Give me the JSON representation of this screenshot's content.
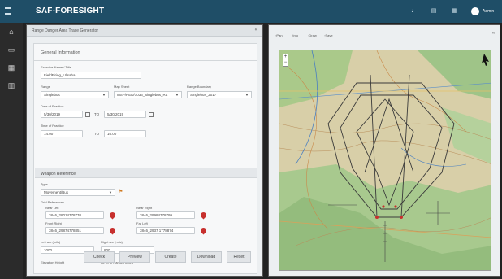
{
  "app": {
    "title": "SAF-FORESIGHT",
    "user": "Admin"
  },
  "topbar": {
    "icons": [
      "bell-icon",
      "document-icon",
      "grid-icon"
    ]
  },
  "leftnav": {
    "items": [
      "home-icon",
      "inbox-icon",
      "calendar-icon",
      "chart-icon"
    ]
  },
  "panel": {
    "title": "Range Danger Area Trace Generator",
    "collapse": "«"
  },
  "general": {
    "title": "General Information",
    "exercise_label": "Exercise Name / Title",
    "exercise_value": "FieldFiring_Ulisaba",
    "range_label": "Range",
    "range_value": "Singlebus",
    "map_label": "Map Sheet",
    "map_value": "MSP/RED/1036_Singlebus_Ra",
    "datum_label": "Range Boundary",
    "datum_value": "Singlebus_2017",
    "date_label": "Date of Practice",
    "date_from": "5/30/2019",
    "date_to_label": "TO",
    "date_to": "5/30/2019",
    "time_label": "Time of Practice",
    "time_from": "14:00",
    "time_to_label": "TO",
    "time_to": "16:00"
  },
  "weapon": {
    "title": "Weapon Reference",
    "type_label": "Type",
    "type_value": "Movement/Bus",
    "grid_label": "Grid References",
    "near_left_label": "Near Left",
    "near_left": "3846_28014778770",
    "near_right_label": "Near Right",
    "near_right": "3846_29984778799",
    "front_right_label": "Front Right",
    "front_right": "3846_29874778851",
    "far_left_label": "Far Left",
    "far_left": "3846_2937 1778874",
    "left_arc_label": "Left arc (mils)",
    "left_arc": "1000",
    "right_arc_label": "Right arc (mils)",
    "right_arc": "800",
    "elevation_label": "Elevation Height",
    "target_label": "Ht. % of Range Height"
  },
  "buttons": {
    "check": "Check",
    "preview": "Preview",
    "create": "Create",
    "download": "Download",
    "reset": "Reset"
  },
  "map": {
    "tools": [
      "Pan",
      "Info",
      "Draw",
      "Save"
    ],
    "close": "«",
    "zoom_in": "+",
    "zoom_out": "−"
  }
}
